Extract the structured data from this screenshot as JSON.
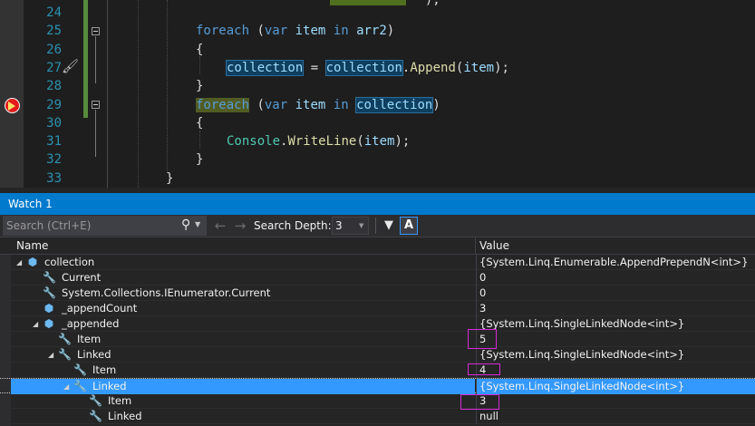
{
  "editor": {
    "lines": [
      {
        "num": "24",
        "tokens": []
      },
      {
        "num": "25",
        "tokens": [
          [
            "kw",
            "foreach"
          ],
          [
            "pl",
            " ("
          ],
          [
            "kw",
            "var"
          ],
          [
            "pl",
            " "
          ],
          [
            "id",
            "item"
          ],
          [
            "pl",
            " "
          ],
          [
            "kw",
            "in"
          ],
          [
            "pl",
            " "
          ],
          [
            "id",
            "arr2"
          ],
          [
            "pl",
            ")"
          ]
        ]
      },
      {
        "num": "26",
        "tokens": [
          [
            "pl",
            "{"
          ]
        ]
      },
      {
        "num": "27",
        "tokens": [
          [
            "id",
            "collection"
          ],
          [
            "pl",
            " = "
          ],
          [
            "id",
            "collection"
          ],
          [
            "pl",
            "."
          ],
          [
            "fn",
            "Append"
          ],
          [
            "pl",
            "("
          ],
          [
            "id",
            "item"
          ],
          [
            "pl",
            ");"
          ]
        ]
      },
      {
        "num": "28",
        "tokens": [
          [
            "pl",
            "}"
          ]
        ]
      },
      {
        "num": "29",
        "tokens": [
          [
            "kw",
            "foreach"
          ],
          [
            "pl",
            " ("
          ],
          [
            "kw",
            "var"
          ],
          [
            "pl",
            " "
          ],
          [
            "id",
            "item"
          ],
          [
            "pl",
            " "
          ],
          [
            "kw",
            "in"
          ],
          [
            "pl",
            " "
          ],
          [
            "id",
            "collection"
          ],
          [
            "pl",
            ")"
          ]
        ]
      },
      {
        "num": "30",
        "tokens": [
          [
            "pl",
            "{"
          ]
        ]
      },
      {
        "num": "31",
        "tokens": [
          [
            "ty",
            "Console"
          ],
          [
            "pl",
            "."
          ],
          [
            "fn",
            "WriteLine"
          ],
          [
            "pl",
            "("
          ],
          [
            "id",
            "item"
          ],
          [
            "pl",
            ");"
          ]
        ]
      },
      {
        "num": "32",
        "tokens": [
          [
            "pl",
            "}"
          ]
        ]
      },
      {
        "num": "33",
        "tokens": [
          [
            "pl",
            "}"
          ]
        ]
      }
    ],
    "fragment_line_24": "  );"
  },
  "watch": {
    "title": "Watch 1",
    "search_placeholder": "Search (Ctrl+E)",
    "search_depth_label": "Search Depth:",
    "search_depth_value": "3",
    "case_button_label": "A",
    "columns": {
      "name": "Name",
      "value": "Value"
    },
    "rows": [
      {
        "name": "collection",
        "value": "{System.Linq.Enumerable.AppendPrependN<int>}"
      },
      {
        "name": "Current",
        "value": "0"
      },
      {
        "name": "System.Collections.IEnumerator.Current",
        "value": "0"
      },
      {
        "name": "_appendCount",
        "value": "3"
      },
      {
        "name": "_appended",
        "value": "{System.Linq.SingleLinkedNode<int>}"
      },
      {
        "name": "Item",
        "value": "5"
      },
      {
        "name": "Linked",
        "value": "{System.Linq.SingleLinkedNode<int>}"
      },
      {
        "name": "Item",
        "value": "4"
      },
      {
        "name": "Linked",
        "value": "{System.Linq.SingleLinkedNode<int>}"
      },
      {
        "name": "Item",
        "value": "3"
      },
      {
        "name": "Linked",
        "value": "null"
      }
    ]
  }
}
